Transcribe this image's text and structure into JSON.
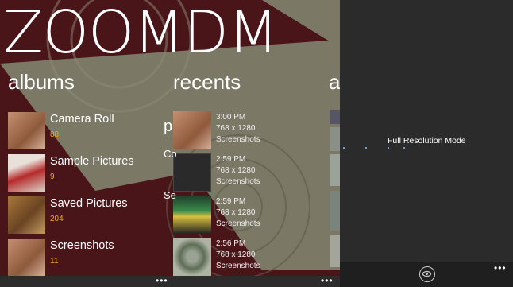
{
  "app": {
    "title": "ZOOMDM"
  },
  "albums": {
    "heading": "albums",
    "items": [
      {
        "name": "Camera Roll",
        "count": "88"
      },
      {
        "name": "Sample Pictures",
        "count": "9"
      },
      {
        "name": "Saved Pictures",
        "count": "204"
      },
      {
        "name": "Screenshots",
        "count": "11"
      }
    ]
  },
  "recents": {
    "heading": "recents",
    "items": [
      {
        "time": "3:00 PM",
        "resolution": "768 x 1280",
        "folder": "Screenshots"
      },
      {
        "time": "2:59 PM",
        "resolution": "768 x 1280",
        "folder": "Screenshots"
      },
      {
        "time": "2:59 PM",
        "resolution": "768 x 1280",
        "folder": "Screenshots"
      },
      {
        "time": "2:56 PM",
        "resolution": "768 x 1280",
        "folder": "Screenshots"
      }
    ]
  },
  "peek": {
    "next_heading_letter": "a",
    "p_letter": "p",
    "c_letters": "Co",
    "s_letters": "Se"
  },
  "appbar": {
    "more": "•••"
  },
  "viewer": {
    "mode_label": "Full Resolution Mode",
    "more": "•••"
  },
  "colors": {
    "accent": "#f5a623",
    "background": "#4a1518",
    "panel": "#2b2b2b"
  }
}
